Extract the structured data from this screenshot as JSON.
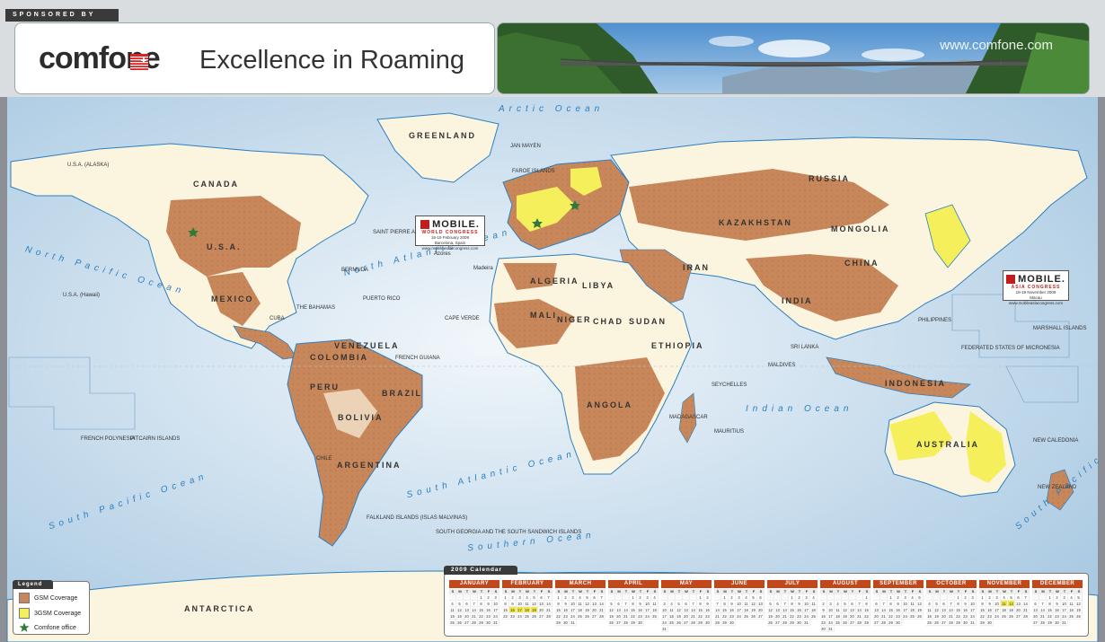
{
  "header": {
    "sponsor_label": "SPONSORED BY",
    "logo": "comfone",
    "tagline": "Excellence in Roaming",
    "website": "www.comfone.com"
  },
  "colors": {
    "gsm": "#c8875a",
    "gsm3": "#f4ef5a",
    "ocean": "#bdd5e8",
    "land": "#fbf4df",
    "accent": "#c21d1d"
  },
  "map": {
    "oceans": {
      "arctic": "Arctic Ocean",
      "north_pacific": "North Pacific Ocean",
      "north_atlantic": "North Atlantic Ocean",
      "south_atlantic": "South Atlantic Ocean",
      "south_pacific_left": "South Pacific Ocean",
      "south_pacific_right": "South Pacific Ocean",
      "indian": "Indian Ocean",
      "southern": "Southern Ocean"
    },
    "regions": {
      "greenland": "GREENLAND",
      "canada": "CANADA",
      "usa_alaska": "U.S.A. (ALASKA)",
      "russia": "RUSSIA",
      "kazakhstan": "KAZAKHSTAN",
      "mongolia": "MONGOLIA",
      "algeria": "ALGERIA",
      "libya": "LIBYA",
      "mali": "MALI",
      "niger": "NIGER",
      "chad": "CHAD",
      "sudan": "SUDAN",
      "ethiopia": "ETHIOPIA",
      "angola": "ANGOLA",
      "brazil": "BRAZIL",
      "bolivia": "BOLIVIA",
      "colombia": "COLOMBIA",
      "venezuela": "VENEZUELA",
      "peru": "PERU",
      "argentina": "ARGENTINA",
      "chile": "CHILE",
      "australia": "AUSTRALIA",
      "indonesia": "INDONESIA",
      "india": "INDIA",
      "china": "CHINA",
      "iran": "IRAN",
      "antarctica": "ANTARCTICA",
      "french_polynesia": "FRENCH POLYNESIA",
      "pitcairn": "PITCAIRN ISLANDS",
      "federated_micronesia": "FEDERATED STATES OF MICRONESIA",
      "marshall_islands": "MARSHALL ISLANDS",
      "new_caledonia": "NEW CALEDONIA",
      "falkland": "FALKLAND ISLANDS (ISLAS MALVINAS)",
      "south_georgia": "SOUTH GEORGIA AND THE SOUTH SANDWICH ISLANDS",
      "french_guiana": "FRENCH GUIANA",
      "maldives": "MALDIVES",
      "seychelles": "SEYCHELLES",
      "mauritius": "MAURITIUS",
      "madagascar": "MADAGASCAR",
      "bermuda": "BERMUDA",
      "azores": "Azores",
      "madeira": "Madeira",
      "cape_verde": "CAPE VERDE",
      "saint_pierre": "SAINT PIERRE AND MIQUELON",
      "faroe": "FAROE ISLANDS",
      "jan_mayen": "JAN MAYEN",
      "usa_hawaii": "U.S.A. (Hawaii)",
      "bahamas": "THE BAHAMAS",
      "puerto_rico": "PUERTO RICO",
      "cuba": "CUBA",
      "mexico": "MEXICO",
      "usa": "U.S.A.",
      "sri_lanka": "SRI LANKA",
      "new_zealand": "NEW ZEALAND",
      "philippines": "PHILIPPINES"
    },
    "callout_mwc": {
      "name": "MOBILE.",
      "sub": "WORLD CONGRESS",
      "dates": "16-19 February 2009",
      "city": "Barcelona, Spain",
      "url": "www.mobileworldcongress.com"
    },
    "callout_mac": {
      "name": "MOBILE.",
      "sub": "ASIA CONGRESS",
      "dates": "18-19 November 2009",
      "city": "Macau",
      "url": "www.mobileasiacongress.com"
    }
  },
  "legend": {
    "title": "Legend",
    "items": [
      {
        "label": "GSM Coverage",
        "color": "#c8875a"
      },
      {
        "label": "3GSM Coverage",
        "color": "#f4ef5a"
      },
      {
        "label": "Comfone office",
        "icon": "star-icon"
      }
    ]
  },
  "calendar": {
    "title": "2009 Calendar",
    "weekdays": [
      "S",
      "M",
      "T",
      "W",
      "T",
      "F",
      "S"
    ],
    "months": [
      {
        "name": "JANUARY",
        "start": 4,
        "days": 31,
        "highlight": []
      },
      {
        "name": "FEBRUARY",
        "start": 0,
        "days": 28,
        "highlight": [
          16,
          17,
          18,
          19
        ]
      },
      {
        "name": "MARCH",
        "start": 0,
        "days": 31,
        "highlight": []
      },
      {
        "name": "APRIL",
        "start": 3,
        "days": 30,
        "highlight": []
      },
      {
        "name": "MAY",
        "start": 5,
        "days": 31,
        "highlight": []
      },
      {
        "name": "JUNE",
        "start": 1,
        "days": 30,
        "highlight": []
      },
      {
        "name": "JULY",
        "start": 3,
        "days": 31,
        "highlight": []
      },
      {
        "name": "AUGUST",
        "start": 6,
        "days": 31,
        "highlight": []
      },
      {
        "name": "SEPTEMBER",
        "start": 2,
        "days": 30,
        "highlight": []
      },
      {
        "name": "OCTOBER",
        "start": 4,
        "days": 31,
        "highlight": []
      },
      {
        "name": "NOVEMBER",
        "start": 0,
        "days": 30,
        "highlight": [
          11,
          12
        ]
      },
      {
        "name": "DECEMBER",
        "start": 2,
        "days": 31,
        "highlight": []
      }
    ]
  }
}
